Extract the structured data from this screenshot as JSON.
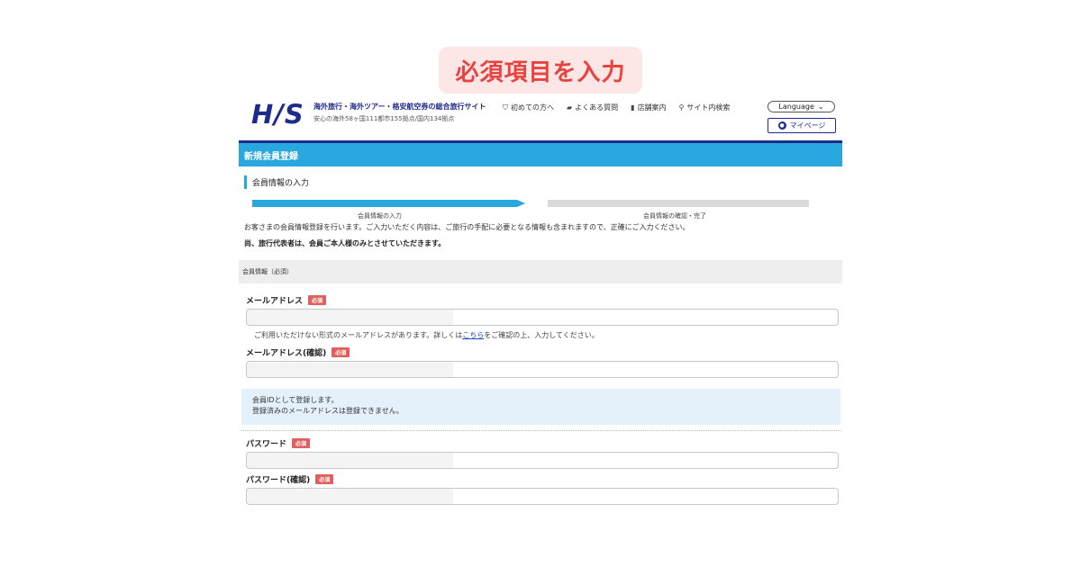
{
  "banner": {
    "text": "必須項目を入力"
  },
  "header": {
    "logo": "H/S",
    "tagline": "海外旅行・海外ツアー・格安航空券の総合旅行サイト",
    "subline": "安心の海外58ヶ国111都市155拠点/国内134拠点",
    "nav": [
      {
        "icon": "shield-icon",
        "label": "初めての方へ"
      },
      {
        "icon": "chat-icon",
        "label": "よくある質問"
      },
      {
        "icon": "building-icon",
        "label": "店舗案内"
      },
      {
        "icon": "search-icon",
        "label": "サイト内検索"
      }
    ],
    "language": "Language",
    "mypage": "マイページ"
  },
  "page": {
    "title": "新規会員登録",
    "section_heading": "会員情報の入力",
    "steps": [
      {
        "label": "会員情報の入力",
        "active": true
      },
      {
        "label": "会員情報の確認・完了",
        "active": false
      }
    ],
    "intro": "お客さまの会員情報登録を行います。ご入力いただく内容は、ご旅行の手配に必要となる情報も含まれますので、正確にご入力ください。",
    "intro_bold": "尚、旅行代表者は、会員ご本人様のみとさせていただきます。",
    "section_bar": "会員情報（必須）"
  },
  "form": {
    "required_badge": "必須",
    "email_label": "メールアドレス",
    "email_confirm_label": "メールアドレス(確認)",
    "note_before": "ご利用いただけない形式のメールアドレスがあります。詳しくは",
    "note_link": "こちら",
    "note_after": "をご確認の上、入力してください。",
    "info_line1": "会員IDとして登録します。",
    "info_line2": "登録済みのメールアドレスは登録できません。",
    "password_label": "パスワード",
    "password_confirm_label": "パスワード(確認)"
  },
  "colors": {
    "brand": "#1e2a8c",
    "accent": "#29a8e0",
    "required": "#e06060",
    "banner_text": "#e8433f"
  }
}
